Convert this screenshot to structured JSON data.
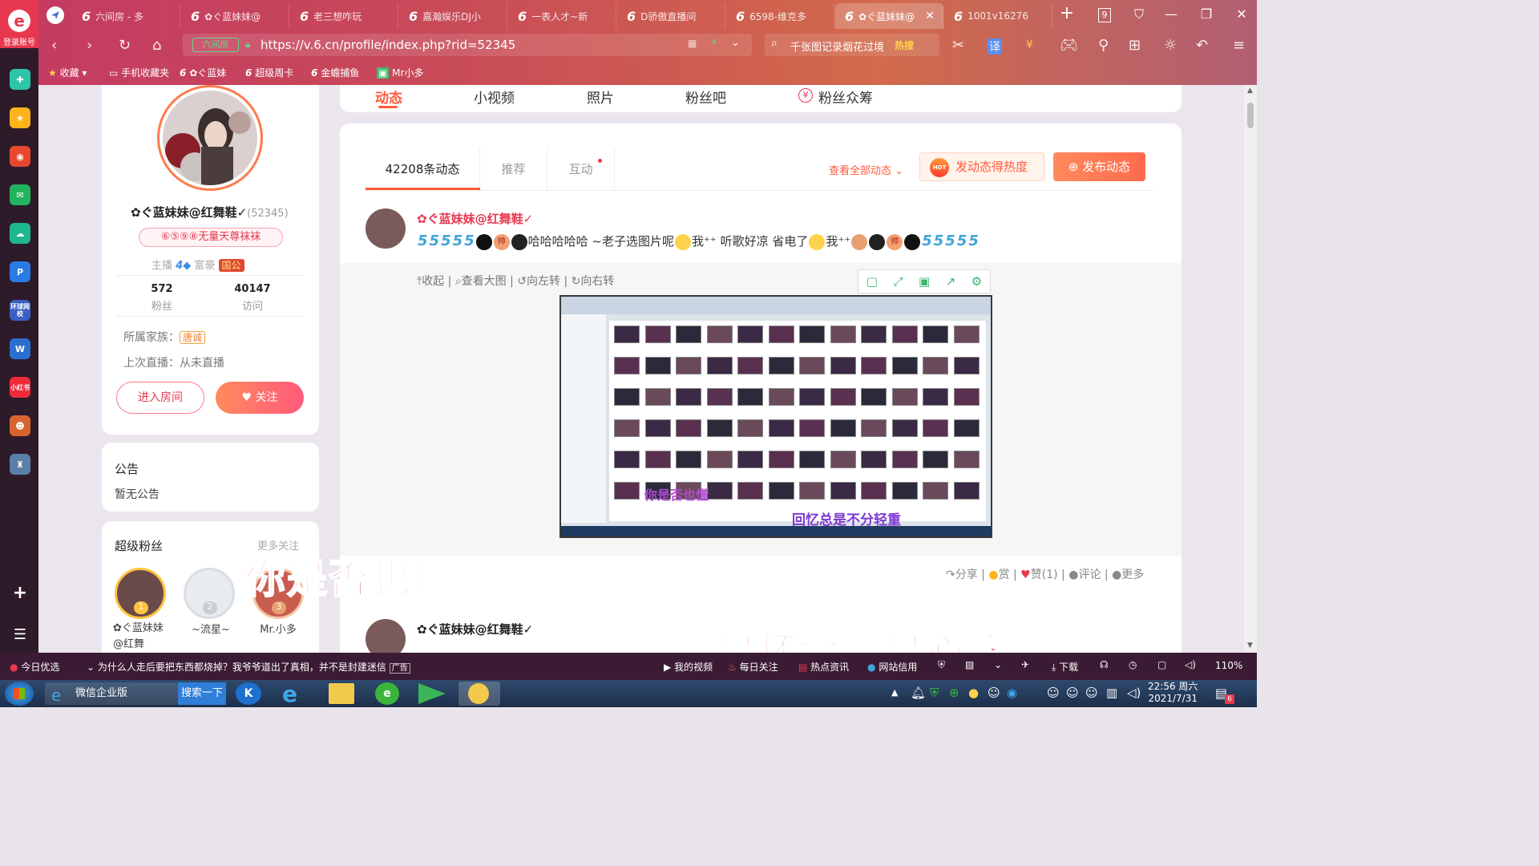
{
  "browser": {
    "logo_label": "登录账号",
    "tabs": [
      {
        "label": "六间房 - 多"
      },
      {
        "label": "✿ぐ蓝妹妹@"
      },
      {
        "label": "老三想咋玩"
      },
      {
        "label": "嘉瀚娱乐DJ小"
      },
      {
        "label": "一表人才~新"
      },
      {
        "label": "D骄傲直播间"
      },
      {
        "label": "6598-维克多"
      },
      {
        "label": "✿ぐ蓝妹妹@",
        "active": true
      },
      {
        "label": "1001v16276"
      }
    ],
    "tab_count_badge": "9",
    "url_prefix": "六间房",
    "url": "https://v.6.cn/profile/index.php?rid=52345",
    "search_placeholder": "千张图记录烟花过境",
    "search_hot": "热搜",
    "bookmarks": [
      {
        "label": "收藏"
      },
      {
        "label": "手机收藏夹"
      },
      {
        "label": "✿ぐ蓝妹"
      },
      {
        "label": "超级周卡"
      },
      {
        "label": "金蟾捕鱼"
      },
      {
        "label": "Mr小多"
      }
    ]
  },
  "sidebar_apps": [
    "",
    "",
    "",
    "",
    "",
    "",
    "环球网校",
    "",
    "小红书",
    "",
    ""
  ],
  "profile": {
    "nav_tabs": [
      "动态",
      "小视频",
      "照片",
      "粉丝吧",
      "粉丝众筹"
    ],
    "name": "✿ぐ蓝妹妹@红舞鞋✓",
    "rid": "(52345)",
    "badge": "⑥⑤⑨⑧无量天尊袜袜",
    "role_anchor": "主播",
    "anchor_level": "4",
    "role_rich": "富豪",
    "rich_badge": "国公",
    "fans_count": "572",
    "fans_label": "粉丝",
    "visits_count": "40147",
    "visits_label": "访问",
    "family_label": "所属家族：",
    "family_value": "唐诚",
    "last_live": "上次直播：从未直播",
    "enter_room": "进入房间",
    "follow": "关注"
  },
  "announcement": {
    "title": "公告",
    "body": "暂无公告"
  },
  "superfans": {
    "title": "超级粉丝",
    "more": "更多关注",
    "fans": [
      {
        "rank": "1",
        "name": "✿ぐ蓝妹妹@红舞"
      },
      {
        "rank": "2",
        "name": "~流星~"
      },
      {
        "rank": "3",
        "name": "Mr.小多"
      }
    ]
  },
  "feed": {
    "tabs": [
      "42208条动态",
      "推荐",
      "互动"
    ],
    "view_all": "查看全部动态",
    "hot_button": "发动态得热度",
    "hot_icon_label": "HOT",
    "post_button": "发布动态",
    "post": {
      "author": "✿ぐ蓝妹妹@红舞鞋✓",
      "text_segments": [
        "哈哈哈哈哈 ~老子选图片呢",
        "我⁺⁺ 听歌好凉 省电了",
        "我⁺⁺"
      ],
      "emoji_text": "帅",
      "five_glyph": "5",
      "toolbar": [
        "收起",
        "查看大图",
        "向左转",
        "向右转"
      ],
      "image_caption_1": "你是否也懂",
      "image_caption_2": "回忆总是不分轻重",
      "actions": [
        "分享",
        "赏",
        "赞(1)",
        "评论",
        "更多"
      ]
    },
    "post2_author": "✿ぐ蓝妹妹@红舞鞋✓"
  },
  "overlay_subtitles": [
    "你是否也懂",
    "越是怀念越是心痛"
  ],
  "statusbar": {
    "left": "今日优选",
    "news": "为什么人走后要把东西都烧掉？我爷爷道出了真相，并不是封建迷信",
    "ad": "广告",
    "items": [
      "我的视频",
      "每日关注",
      "热点资讯",
      "网站信用",
      "下载"
    ],
    "zoom": "110%"
  },
  "taskbar": {
    "app_label": "微信企业版",
    "search_label": "搜索一下",
    "time": "22:56 周六",
    "date": "2021/7/31",
    "notify_count": "6"
  },
  "colors": {
    "accent": "#ff5a3c",
    "brand_red": "#e8384f",
    "link": "#3fa4d8"
  }
}
